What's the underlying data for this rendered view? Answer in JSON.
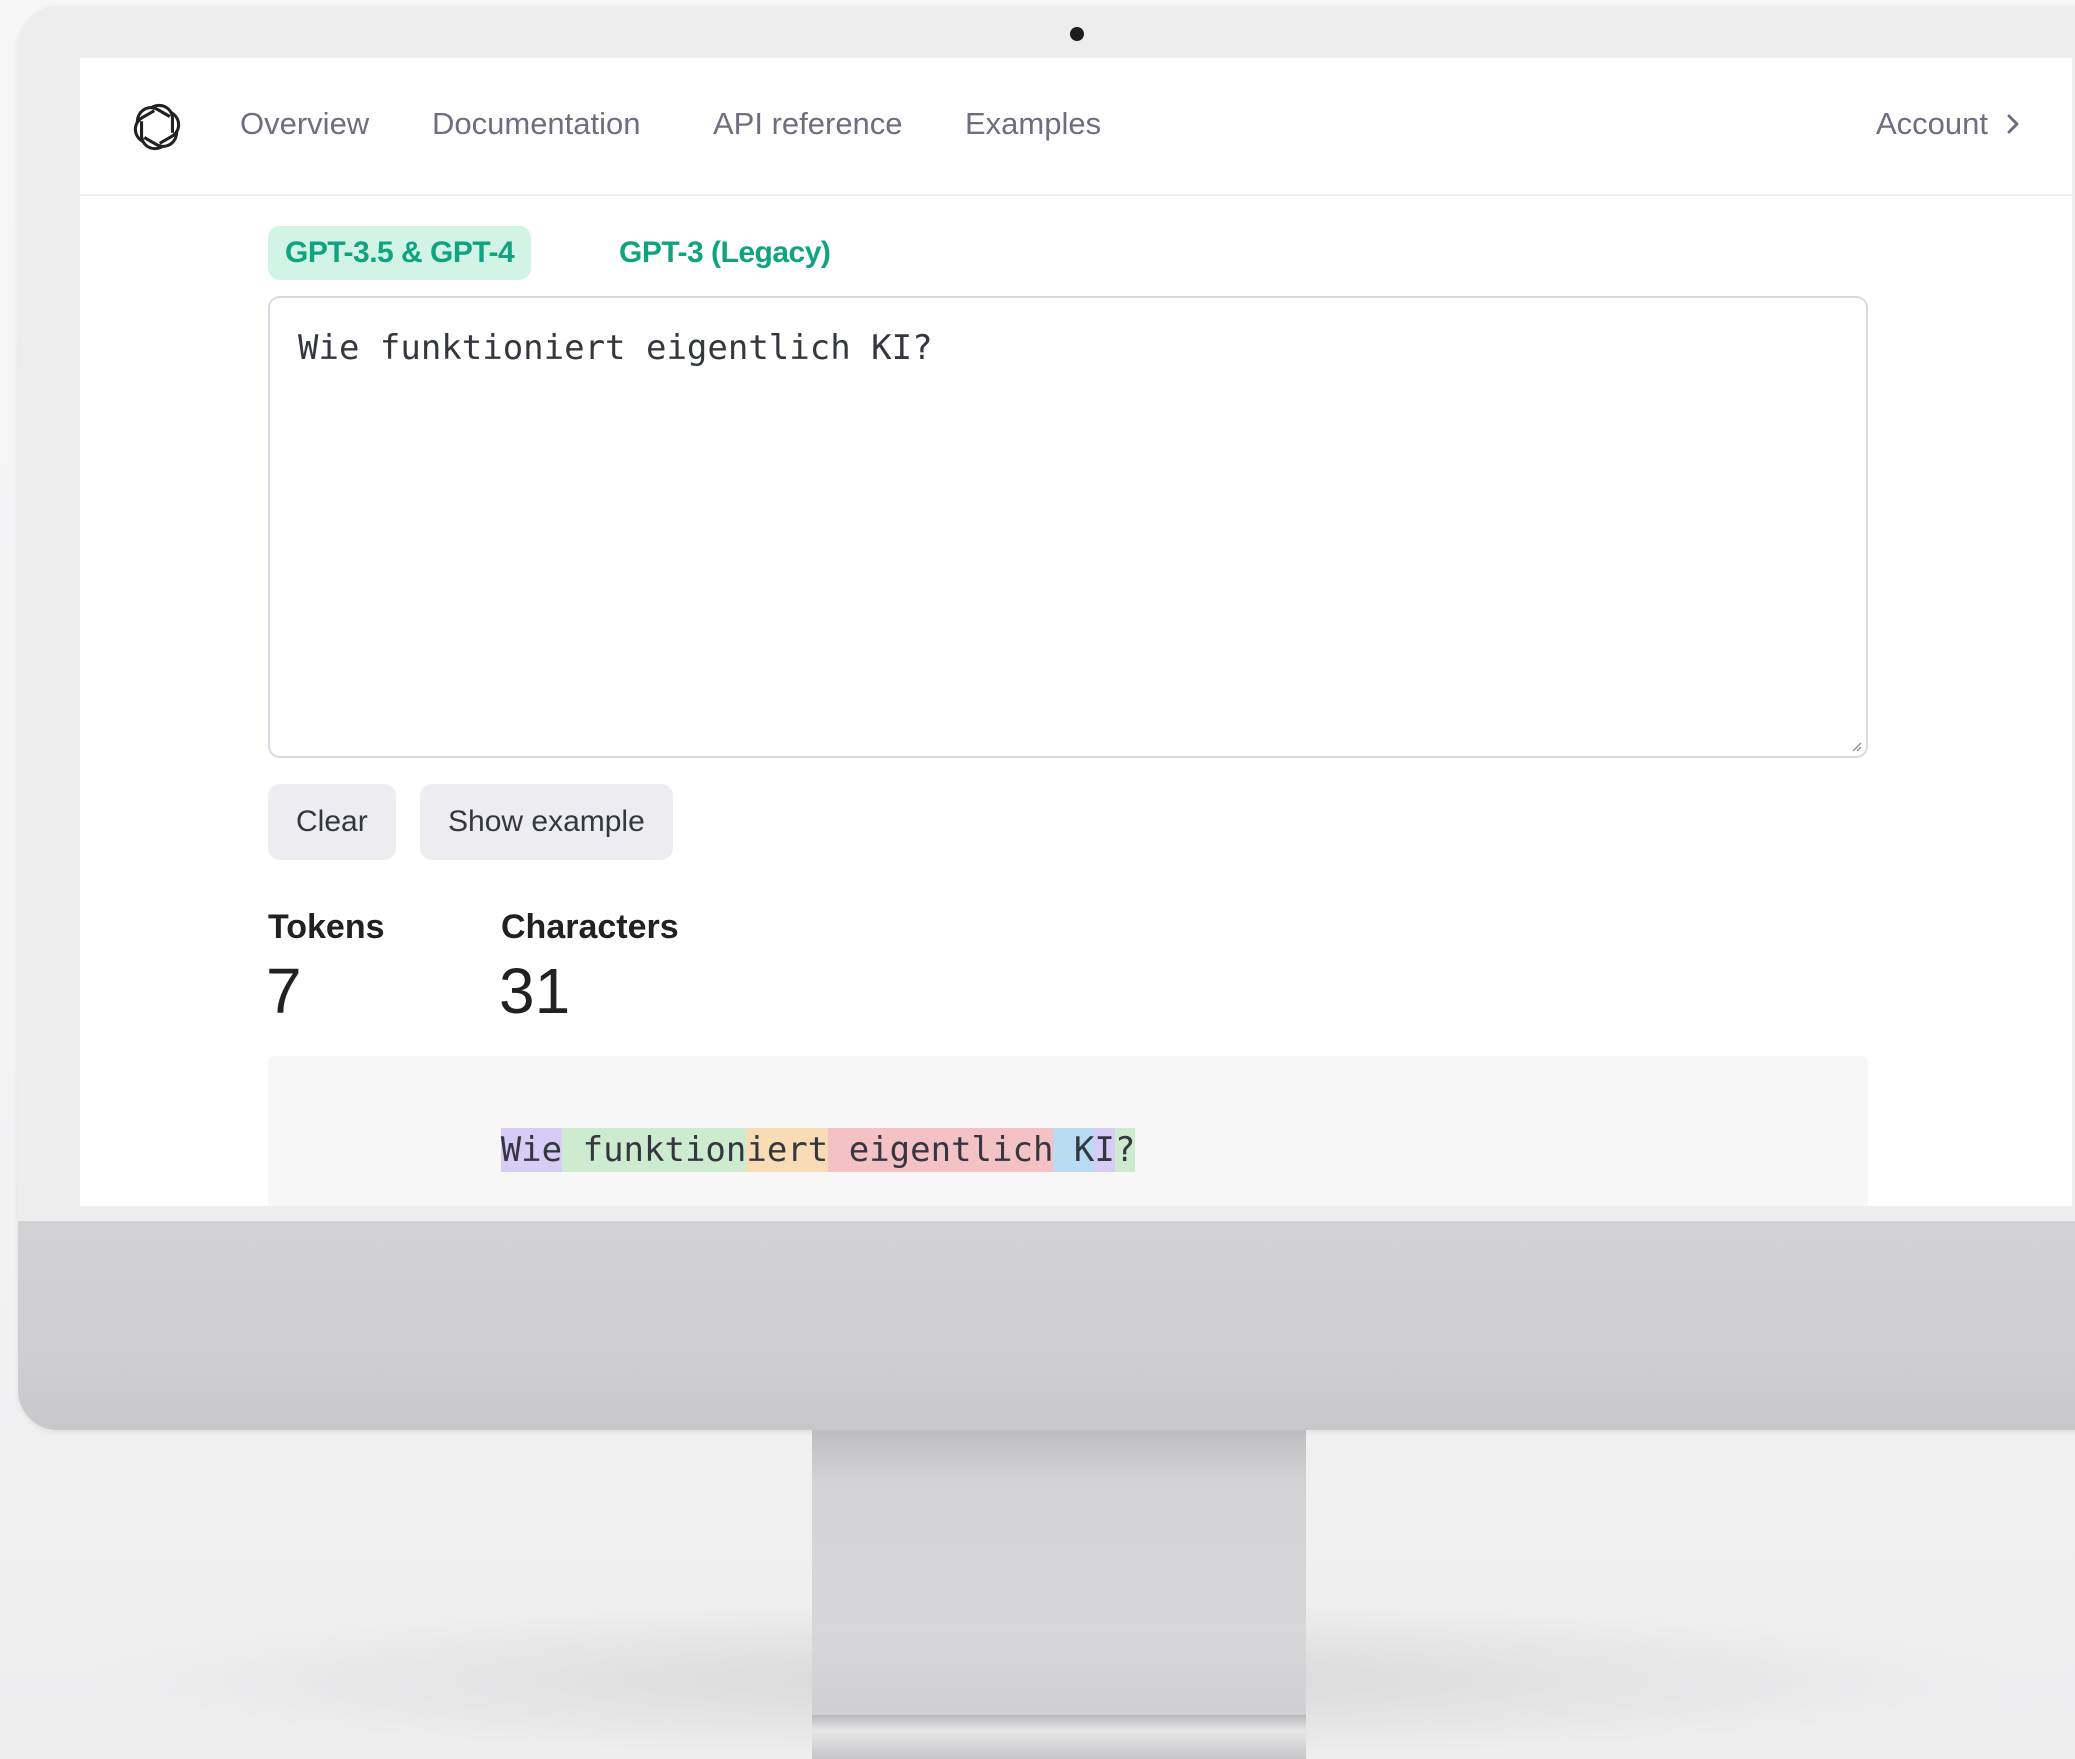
{
  "nav": {
    "links": [
      "Overview",
      "Documentation",
      "API reference",
      "Examples"
    ],
    "account_label": "Account"
  },
  "tabs": [
    {
      "label": "GPT-3.5 & GPT-4",
      "active": true
    },
    {
      "label": "GPT-3 (Legacy)",
      "active": false
    }
  ],
  "prompt": {
    "value": "Wie funktioniert eigentlich KI?"
  },
  "actions": {
    "clear_label": "Clear",
    "example_label": "Show example"
  },
  "stats": {
    "tokens_label": "Tokens",
    "tokens_value": "7",
    "characters_label": "Characters",
    "characters_value": "31"
  },
  "tokens": [
    {
      "text": "Wie",
      "color": "#d7ccf5"
    },
    {
      "text": " funktion",
      "color": "#cdeccf"
    },
    {
      "text": "iert",
      "color": "#f7dcb6"
    },
    {
      "text": " eigentlich",
      "color": "#f4c2c4"
    },
    {
      "text": " K",
      "color": "#b9dcf3"
    },
    {
      "text": "I",
      "color": "#d7ccf5"
    },
    {
      "text": "?",
      "color": "#cdeccf"
    }
  ],
  "colors": {
    "accent": "#10a37f",
    "accent_bg": "#d2f4e6",
    "nav_text": "#6e6e80",
    "button_bg": "#ececf1"
  }
}
